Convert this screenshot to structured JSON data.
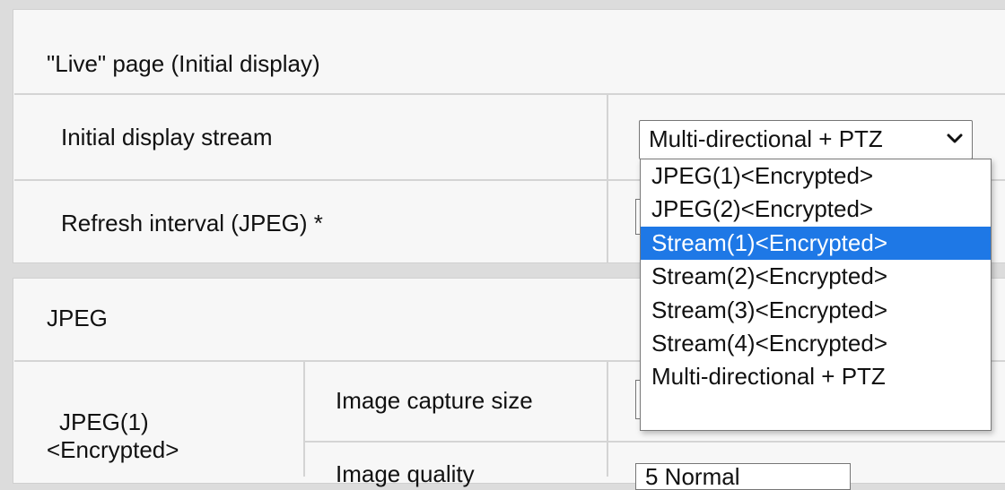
{
  "live_section": {
    "title": "\"Live\" page (Initial display)",
    "rows": [
      {
        "label": "Initial display stream",
        "value": "Multi-directional + PTZ"
      },
      {
        "label": "Refresh interval (JPEG) *"
      }
    ]
  },
  "dropdown": {
    "options": [
      "JPEG(1)<Encrypted>",
      "JPEG(2)<Encrypted>",
      "Stream(1)<Encrypted>",
      "Stream(2)<Encrypted>",
      "Stream(3)<Encrypted>",
      "Stream(4)<Encrypted>",
      "Multi-directional + PTZ"
    ],
    "highlighted_index": 2,
    "highlight_color": "#1e78e6"
  },
  "jpeg_section": {
    "title": "JPEG",
    "group_label_line1": "JPEG(1)",
    "group_label_line2": "<Encrypted>",
    "rows": [
      {
        "label": "Image capture size"
      },
      {
        "label": "Image quality",
        "value": "5 Normal"
      }
    ]
  },
  "icons": {
    "select_arrow": "chevron-down-icon"
  }
}
